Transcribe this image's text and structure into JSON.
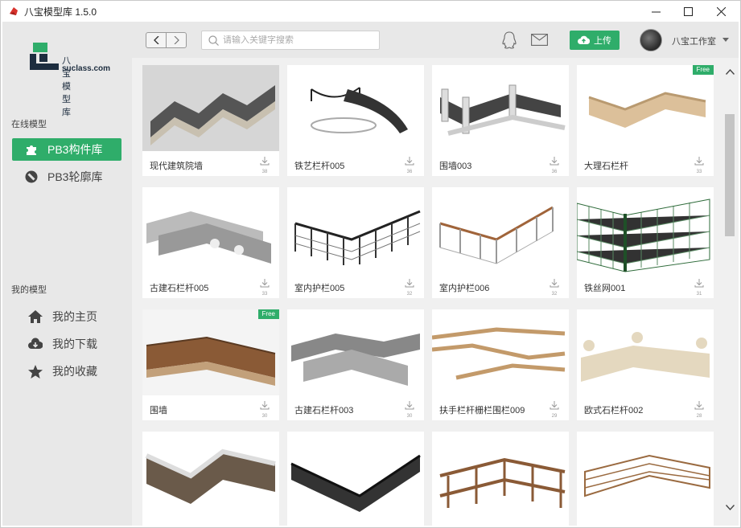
{
  "window": {
    "title": "八宝模型库 1.5.0",
    "minimize_icon": "minimize-icon",
    "maximize_icon": "maximize-icon",
    "close_icon": "close-icon"
  },
  "logo": {
    "cn": "八宝模型库",
    "en": "suclass.com"
  },
  "sidebar": {
    "online_label": "在线模型",
    "online_items": [
      {
        "label": "PB3构件库",
        "icon": "puzzle-icon",
        "active": true
      },
      {
        "label": "PB3轮廓库",
        "icon": "slash-circle-icon",
        "active": false
      }
    ],
    "mine_label": "我的模型",
    "mine_items": [
      {
        "label": "我的主页",
        "icon": "home-icon"
      },
      {
        "label": "我的下载",
        "icon": "cloud-download-icon"
      },
      {
        "label": "我的收藏",
        "icon": "star-icon"
      }
    ]
  },
  "header": {
    "search_placeholder": "请输入关键字搜索",
    "upload_label": "上传",
    "username": "八宝工作室"
  },
  "colors": {
    "accent": "#2fad6a",
    "sidebar_bg": "#e8e8e8",
    "content_bg": "#f0f0f0"
  },
  "cards": [
    {
      "name": "现代建筑院墙",
      "downloads": "38",
      "free": false
    },
    {
      "name": "铁艺栏杆005",
      "downloads": "36",
      "free": false
    },
    {
      "name": "围墙003",
      "downloads": "36",
      "free": false
    },
    {
      "name": "大理石栏杆",
      "downloads": "33",
      "free": true
    },
    {
      "name": "古建石栏杆005",
      "downloads": "33",
      "free": false
    },
    {
      "name": "室内护栏005",
      "downloads": "32",
      "free": false
    },
    {
      "name": "室内护栏006",
      "downloads": "32",
      "free": false
    },
    {
      "name": "铁丝网001",
      "downloads": "31",
      "free": false
    },
    {
      "name": "围墙",
      "downloads": "30",
      "free": true
    },
    {
      "name": "古建石栏杆003",
      "downloads": "30",
      "free": false
    },
    {
      "name": "扶手栏杆栅栏围栏009",
      "downloads": "29",
      "free": false
    },
    {
      "name": "欧式石栏杆002",
      "downloads": "28",
      "free": false
    },
    {
      "name": "",
      "downloads": "",
      "free": false
    },
    {
      "name": "",
      "downloads": "",
      "free": false
    },
    {
      "name": "",
      "downloads": "",
      "free": false
    },
    {
      "name": "",
      "downloads": "",
      "free": false
    }
  ],
  "free_badge": "Free"
}
